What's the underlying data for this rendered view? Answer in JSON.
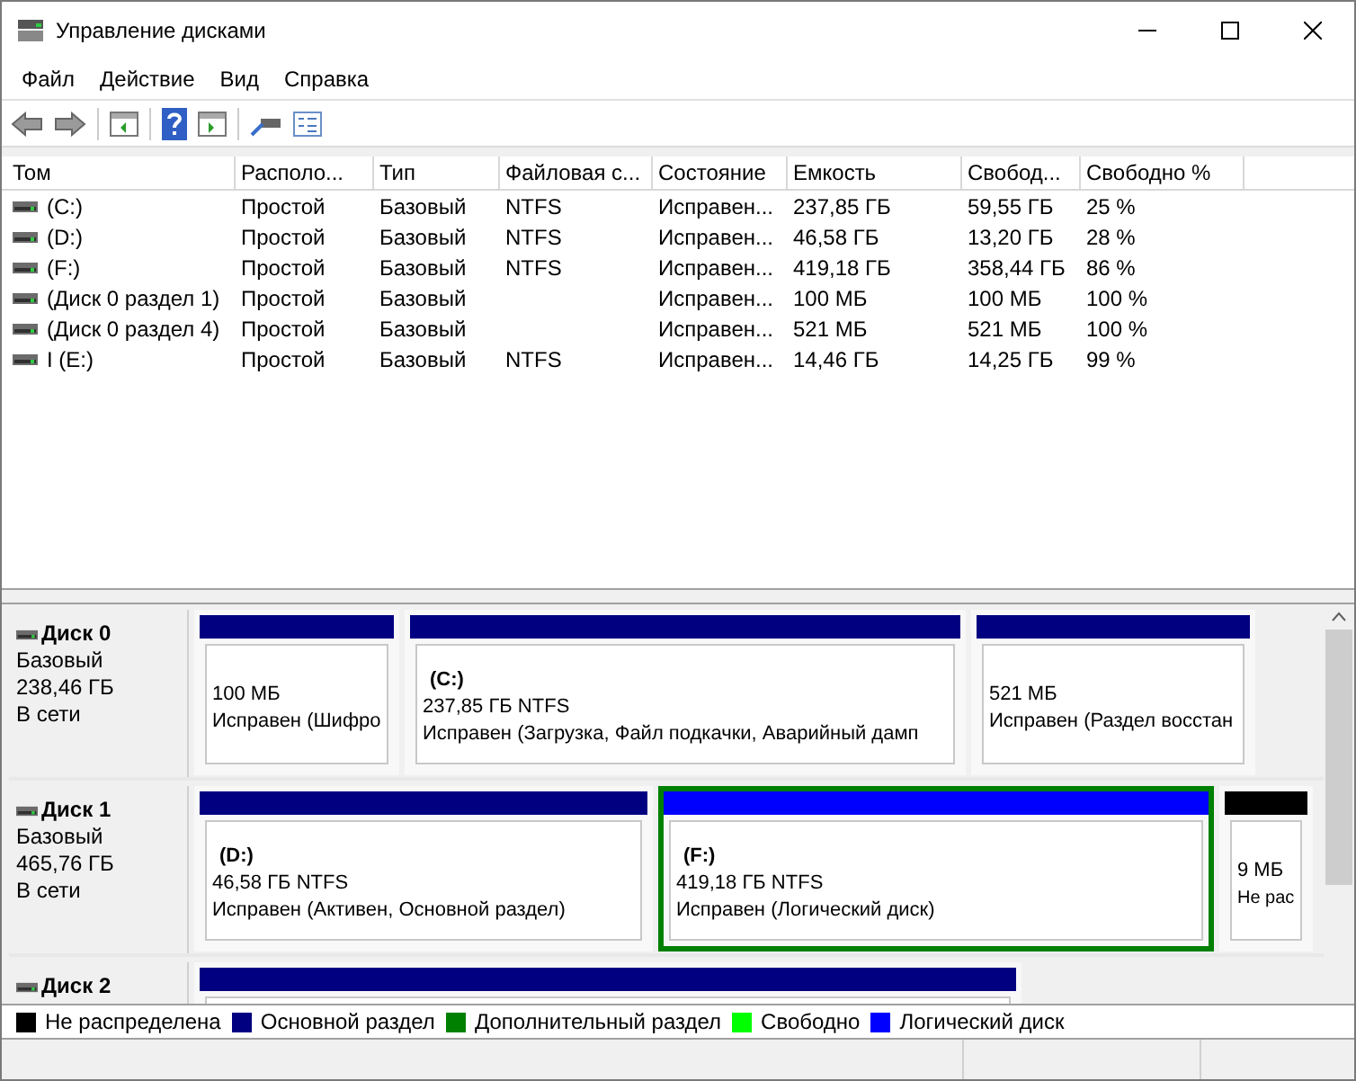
{
  "window": {
    "title": "Управление дисками"
  },
  "menu": [
    "Файл",
    "Действие",
    "Вид",
    "Справка"
  ],
  "table": {
    "columns": [
      "Том",
      "Располо...",
      "Тип",
      "Файловая с...",
      "Состояние",
      "Емкость",
      "Свобод...",
      "Свободно %"
    ],
    "rows": [
      {
        "cells": [
          "(C:)",
          "Простой",
          "Базовый",
          "NTFS",
          "Исправен...",
          "237,85 ГБ",
          "59,55 ГБ",
          "25 %"
        ]
      },
      {
        "cells": [
          "(D:)",
          "Простой",
          "Базовый",
          "NTFS",
          "Исправен...",
          "46,58 ГБ",
          "13,20 ГБ",
          "28 %"
        ]
      },
      {
        "cells": [
          "(F:)",
          "Простой",
          "Базовый",
          "NTFS",
          "Исправен...",
          "419,18 ГБ",
          "358,44 ГБ",
          "86 %"
        ]
      },
      {
        "cells": [
          "(Диск 0 раздел 1)",
          "Простой",
          "Базовый",
          "",
          "Исправен...",
          "100 МБ",
          "100 МБ",
          "100 %"
        ]
      },
      {
        "cells": [
          "(Диск 0 раздел 4)",
          "Простой",
          "Базовый",
          "",
          "Исправен...",
          "521 МБ",
          "521 МБ",
          "100 %"
        ]
      },
      {
        "cells": [
          "I (E:)",
          "Простой",
          "Базовый",
          "NTFS",
          "Исправен...",
          "14,46 ГБ",
          "14,25 ГБ",
          "99 %"
        ]
      }
    ]
  },
  "disks": [
    {
      "name": "Диск 0",
      "type": "Базовый",
      "size": "238,46 ГБ",
      "status": "В сети",
      "partitions": [
        {
          "kind": "primary",
          "extended": false,
          "size": "100 МБ",
          "status": "Исправен (Шифро"
        },
        {
          "kind": "primary",
          "extended": false,
          "label": "(C:)",
          "size": "237,85 ГБ NTFS",
          "status": "Исправен (Загрузка, Файл подкачки, Аварийный дамп"
        },
        {
          "kind": "primary",
          "extended": false,
          "size": "521 МБ",
          "status": "Исправен (Раздел восстан"
        }
      ]
    },
    {
      "name": "Диск 1",
      "type": "Базовый",
      "size": "465,76 ГБ",
      "status": "В сети",
      "partitions": [
        {
          "kind": "primary",
          "extended": false,
          "label": "(D:)",
          "size": "46,58 ГБ NTFS",
          "status": "Исправен (Активен, Основной раздел)"
        },
        {
          "kind": "logical",
          "extended": true,
          "label": "(F:)",
          "size": "419,18 ГБ NTFS",
          "status": "Исправен (Логический диск)"
        },
        {
          "kind": "unallocated",
          "extended": false,
          "size": "9 МБ",
          "status": "Не рас"
        }
      ]
    },
    {
      "name": "Диск 2",
      "partitions": [
        {
          "kind": "primary",
          "extended": false
        }
      ]
    }
  ],
  "legend": [
    {
      "label": "Не распределена",
      "color": "#000000"
    },
    {
      "label": "Основной раздел",
      "color": "#000080"
    },
    {
      "label": "Дополнительный раздел",
      "color": "#008000"
    },
    {
      "label": "Свободно",
      "color": "#00ff00"
    },
    {
      "label": "Логический диск",
      "color": "#0000ff"
    }
  ]
}
